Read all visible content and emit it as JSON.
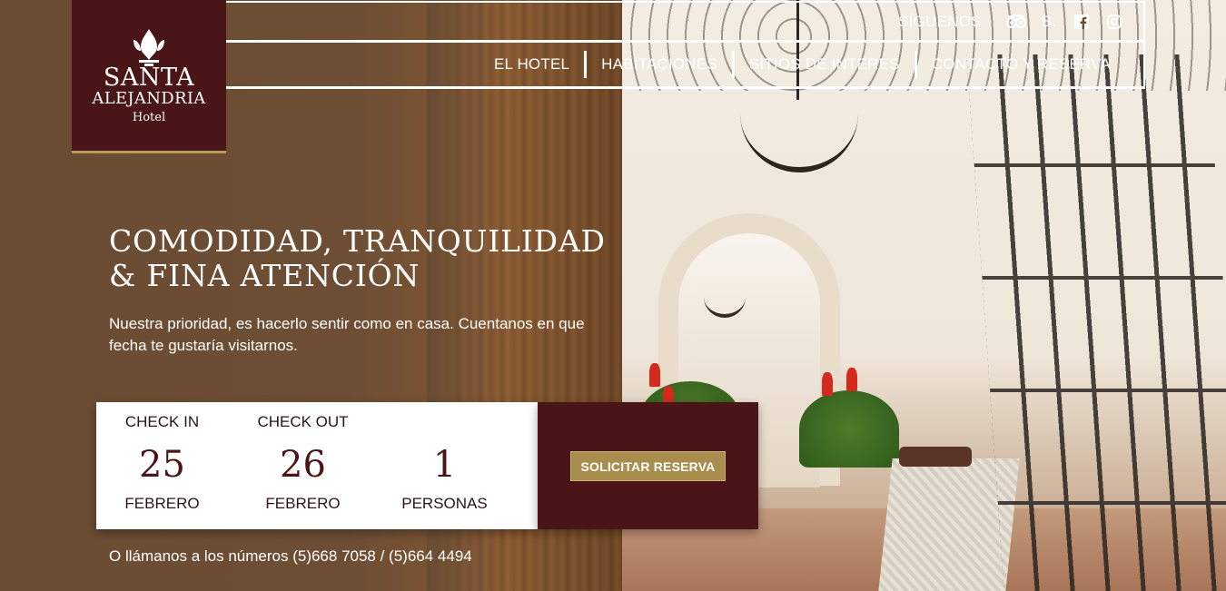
{
  "brand": {
    "name_line1": "SANTA",
    "name_line2": "ALEJANDRIA",
    "name_line3": "Hotel",
    "primary_color": "#4a1517",
    "accent_color": "#a98d4c"
  },
  "social": {
    "label": "SÍGUENOS",
    "icons": [
      {
        "name": "tripadvisor-icon",
        "glyph": "◎◎"
      },
      {
        "name": "booking-icon",
        "glyph": "B."
      },
      {
        "name": "facebook-icon",
        "glyph": "f"
      },
      {
        "name": "instagram-icon",
        "glyph": "◻"
      }
    ]
  },
  "nav": {
    "items": [
      "EL HOTEL",
      "HABITACIONES",
      "SITIOS DE INTERES",
      "CONTACTO Y RESERVA"
    ]
  },
  "hero": {
    "title": "COMODIDAD, TRANQUILIDAD & FINA ATENCIÓN",
    "subtitle": "Nuestra prioridad, es hacerlo sentir como en casa. Cuentanos en que fecha te gustaría visitarnos."
  },
  "booking": {
    "checkin_label": "CHECK IN",
    "checkin_day": "25",
    "checkin_month": "FEBRERO",
    "checkout_label": "CHECK OUT",
    "checkout_day": "26",
    "checkout_month": "FEBRERO",
    "guests_count": "1",
    "guests_label": "PERSONAS",
    "submit_label": "SOLICITAR RESERVA"
  },
  "contact": {
    "phones_text": "O llámanos a los números (5)668 7058 / (5)664 4494"
  }
}
